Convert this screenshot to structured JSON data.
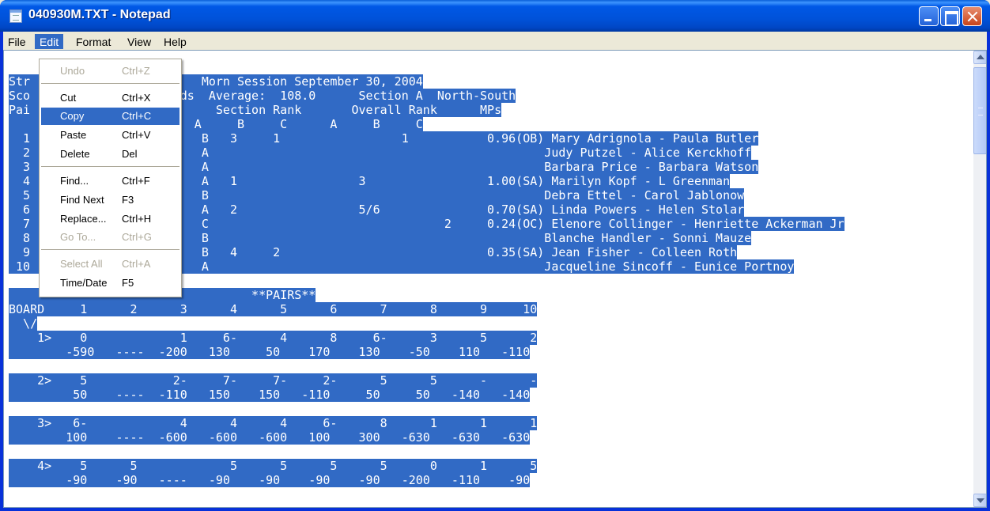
{
  "window": {
    "title": "040930M.TXT - Notepad"
  },
  "menubar": {
    "file": "File",
    "edit": "Edit",
    "format": "Format",
    "view": "View",
    "help": "Help"
  },
  "edit_menu": {
    "undo": {
      "label": "Undo",
      "key": "Ctrl+Z"
    },
    "cut": {
      "label": "Cut",
      "key": "Ctrl+X"
    },
    "copy": {
      "label": "Copy",
      "key": "Ctrl+C"
    },
    "paste": {
      "label": "Paste",
      "key": "Ctrl+V"
    },
    "delete": {
      "label": "Delete",
      "key": "Del"
    },
    "find": {
      "label": "Find...",
      "key": "Ctrl+F"
    },
    "find_next": {
      "label": "Find Next",
      "key": "F3"
    },
    "replace": {
      "label": "Replace...",
      "key": "Ctrl+H"
    },
    "goto": {
      "label": "Go To...",
      "key": "Ctrl+G"
    },
    "select_all": {
      "label": "Select All",
      "key": "Ctrl+A"
    },
    "time_date": {
      "label": "Time/Date",
      "key": "F5"
    }
  },
  "document": {
    "lines": [
      "Str                        Morn Session September 30, 2004",
      "Sco                    rds  Average:  108.0      Section A  North-South",
      "Pai                          Section Rank       Overall Rank      MPs",
      "                          A     B     C      A     B     C",
      "  1                        B   3     1                 1           0.96(OB) Mary Adrignola - Paula Butler",
      "  2                        A                                               Judy Putzel - Alice Kerckhoff",
      "  3                        A                                               Barbara Price - Barbara Watson",
      "  4                        A   1                 3                 1.00(SA) Marilyn Kopf - L Greenman",
      "  5                        B                                               Debra Ettel - Carol Jablonow",
      "  6                        A   2                 5/6               0.70(SA) Linda Powers - Helen Stolar",
      "  7                        C                                 2     0.24(OC) Elenore Collinger - Henriette Ackerman Jr",
      "  8                        B                                               Blanche Handler - Sonni Mauze",
      "  9                        B   4     2                             0.35(SA) Jean Fisher - Colleen Roth",
      " 10                        A                                               Jacqueline Sincoff - Eunice Portnoy",
      "",
      "                                  **PAIRS**",
      "BOARD     1      2      3      4      5      6      7      8      9     10",
      "  \\/",
      "    1>    0             1     6-      4      8     6-      3      5      2",
      "        -590   ----  -200   130     50    170    130    -50    110   -110",
      "",
      "    2>    5            2-     7-     7-     2-      5      5      -      -",
      "         50    ----  -110   150    150   -110     50     50   -140   -140",
      "",
      "    3>   6-             4      4      4     6-      8      1      1      1",
      "        100    ----  -600   -600   -600   100    300   -630   -630   -630",
      "",
      "    4>    5      5             5      5      5      5      0      1      5",
      "        -90    -90   ----   -90    -90    -90    -90   -200   -110    -90"
    ]
  }
}
